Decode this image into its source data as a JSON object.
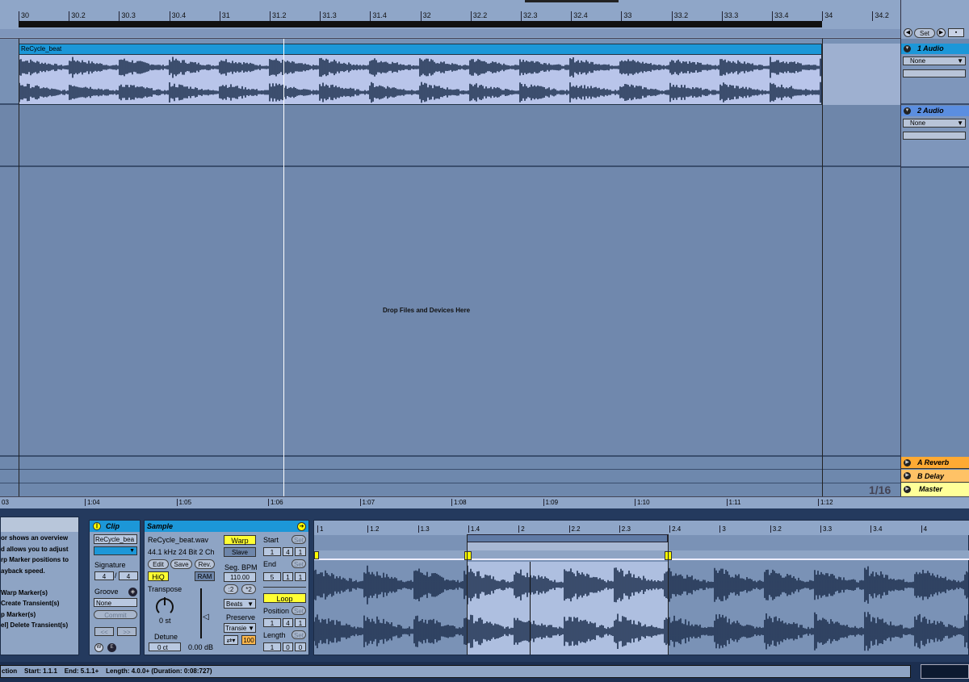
{
  "arrangement": {
    "ruler_ticks": [
      "30",
      "30.2",
      "30.3",
      "30.4",
      "31",
      "31.2",
      "31.3",
      "31.4",
      "32",
      "32.2",
      "32.3",
      "32.4",
      "33",
      "33.2",
      "33.3",
      "33.4",
      "34",
      "34.2"
    ],
    "time_ticks": [
      "03",
      "1:04",
      "1:05",
      "1:06",
      "1:07",
      "1:08",
      "1:09",
      "1:10",
      "1:11",
      "1:12"
    ],
    "clip_name": "ReCycle_beat",
    "drop_text": "Drop Files and Devices Here",
    "zoom": "1/16"
  },
  "mixer": {
    "set_label": "Set",
    "tracks": [
      {
        "name": "1 Audio",
        "input": "None"
      },
      {
        "name": "2 Audio",
        "input": "None"
      }
    ],
    "returns": [
      "A Reverb",
      "B Delay"
    ],
    "master": "Master"
  },
  "info": {
    "lines": [
      "or shows an overview",
      "d allows you to adjust",
      "rp Marker positions to",
      "ayback speed.",
      "",
      "Warp Marker(s)",
      "Create Transient(s)",
      "p Marker(s)",
      "el] Delete Transient(s)"
    ]
  },
  "clip": {
    "title": "Clip",
    "name": "ReCycle_bea",
    "signature_label": "Signature",
    "sig_num": "4",
    "sig_den": "4",
    "groove_label": "Groove",
    "groove_value": "None",
    "commit_label": "Commit"
  },
  "sample": {
    "title": "Sample",
    "file": "ReCycle_beat.wav",
    "format": "44.1 kHz 24 Bit 2 Ch",
    "edit": "Edit",
    "save": "Save",
    "rev": "Rev.",
    "hiq": "HiQ",
    "ram": "RAM",
    "transpose_label": "Transpose",
    "transpose_value": "0 st",
    "detune_label": "Detune",
    "detune_value": "0 ct",
    "gain_value": "0.00 dB",
    "warp": "Warp",
    "slave": "Slave",
    "seg_bpm_label": "Seg. BPM",
    "seg_bpm": "110.00",
    "half": ":2",
    "double": "*2",
    "mode": "Beats",
    "preserve_label": "Preserve",
    "preserve": "Transie",
    "loop_amount": "100",
    "start_label": "Start",
    "start": [
      "1",
      "4",
      "1"
    ],
    "end_label": "End",
    "end": [
      "5",
      "1",
      "1"
    ],
    "loop": "Loop",
    "position_label": "Position",
    "position": [
      "1",
      "4",
      "1"
    ],
    "length_label": "Length",
    "length": [
      "1",
      "0",
      "0"
    ],
    "set": "Set"
  },
  "editor_ruler": [
    "1",
    "1.2",
    "1.3",
    "1.4",
    "2",
    "2.2",
    "2.3",
    "2.4",
    "3",
    "3.2",
    "3.3",
    "3.4",
    "4"
  ],
  "status": {
    "prefix": "ction",
    "start": "Start: 1.1.1",
    "end": "End: 5.1.1+",
    "length": "Length: 4.0.0+ (Duration: 0:08:727)"
  }
}
